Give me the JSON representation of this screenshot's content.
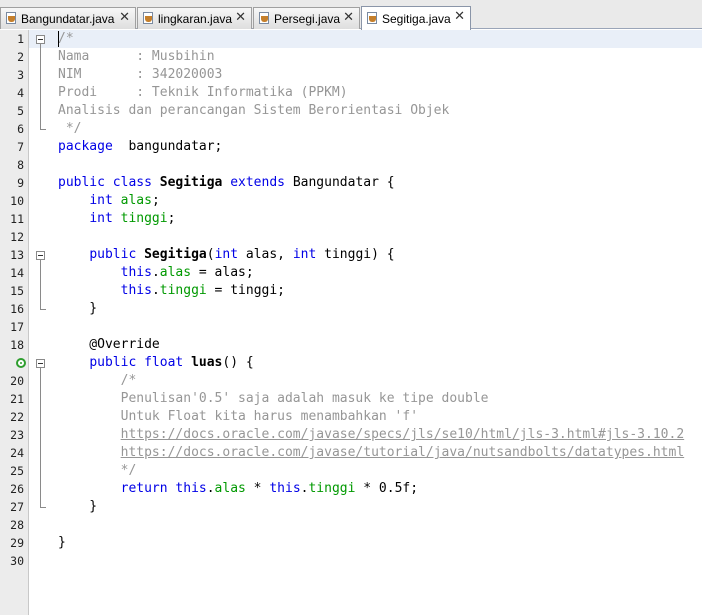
{
  "tabs": [
    {
      "label": "Bangundatar.java",
      "active": false
    },
    {
      "label": "lingkaran.java",
      "active": false
    },
    {
      "label": "Persegi.java",
      "active": false
    },
    {
      "label": "Segitiga.java",
      "active": true
    }
  ],
  "editor": {
    "line_numbers": [
      "1",
      "2",
      "3",
      "4",
      "5",
      "6",
      "7",
      "8",
      "9",
      "10",
      "11",
      "12",
      "13",
      "14",
      "15",
      "16",
      "17",
      "18",
      "19",
      "20",
      "21",
      "22",
      "23",
      "24",
      "25",
      "26",
      "27",
      "28",
      "29",
      "30"
    ],
    "override_icon": "override-annotation-icon",
    "lines": [
      {
        "n": 1,
        "tokens": [
          [
            "cm",
            "/*"
          ]
        ]
      },
      {
        "n": 2,
        "tokens": [
          [
            "cm",
            "Nama      : Musbihin"
          ]
        ]
      },
      {
        "n": 3,
        "tokens": [
          [
            "cm",
            "NIM       : 342020003"
          ]
        ]
      },
      {
        "n": 4,
        "tokens": [
          [
            "cm",
            "Prodi     : Teknik Informatika (PPKM)"
          ]
        ]
      },
      {
        "n": 5,
        "tokens": [
          [
            "cm",
            "Analisis dan perancangan Sistem Berorientasi Objek"
          ]
        ]
      },
      {
        "n": 6,
        "tokens": [
          [
            "cm",
            " */"
          ]
        ]
      },
      {
        "n": 7,
        "tokens": [
          [
            "kw",
            "package"
          ],
          [
            "",
            "  bangundatar;"
          ]
        ]
      },
      {
        "n": 8,
        "tokens": []
      },
      {
        "n": 9,
        "tokens": [
          [
            "kw",
            "public class"
          ],
          [
            "",
            " "
          ],
          [
            "b",
            "Segitiga"
          ],
          [
            "",
            " "
          ],
          [
            "kw",
            "extends"
          ],
          [
            "",
            " Bangundatar {"
          ]
        ]
      },
      {
        "n": 10,
        "tokens": [
          [
            "",
            "    "
          ],
          [
            "kw",
            "int"
          ],
          [
            "",
            " "
          ],
          [
            "fld",
            "alas"
          ],
          [
            "",
            ";"
          ]
        ]
      },
      {
        "n": 11,
        "tokens": [
          [
            "",
            "    "
          ],
          [
            "kw",
            "int"
          ],
          [
            "",
            " "
          ],
          [
            "fld",
            "tinggi"
          ],
          [
            "",
            ";"
          ]
        ]
      },
      {
        "n": 12,
        "tokens": []
      },
      {
        "n": 13,
        "tokens": [
          [
            "",
            "    "
          ],
          [
            "kw",
            "public"
          ],
          [
            "",
            " "
          ],
          [
            "b",
            "Segitiga"
          ],
          [
            "",
            "("
          ],
          [
            "kw",
            "int"
          ],
          [
            "",
            " alas, "
          ],
          [
            "kw",
            "int"
          ],
          [
            "",
            " tinggi) {"
          ]
        ]
      },
      {
        "n": 14,
        "tokens": [
          [
            "",
            "        "
          ],
          [
            "kw",
            "this"
          ],
          [
            "",
            "."
          ],
          [
            "fld",
            "alas"
          ],
          [
            "",
            " = alas;"
          ]
        ]
      },
      {
        "n": 15,
        "tokens": [
          [
            "",
            "        "
          ],
          [
            "kw",
            "this"
          ],
          [
            "",
            "."
          ],
          [
            "fld",
            "tinggi"
          ],
          [
            "",
            " = tinggi;"
          ]
        ]
      },
      {
        "n": 16,
        "tokens": [
          [
            "",
            "    }"
          ]
        ]
      },
      {
        "n": 17,
        "tokens": []
      },
      {
        "n": 18,
        "tokens": [
          [
            "",
            "    @Override"
          ]
        ]
      },
      {
        "n": 19,
        "tokens": [
          [
            "",
            "    "
          ],
          [
            "kw",
            "public float"
          ],
          [
            "",
            " "
          ],
          [
            "b",
            "luas"
          ],
          [
            "",
            "() {"
          ]
        ]
      },
      {
        "n": 20,
        "tokens": [
          [
            "",
            "        "
          ],
          [
            "cm",
            "/*"
          ]
        ]
      },
      {
        "n": 21,
        "tokens": [
          [
            "",
            "        "
          ],
          [
            "cm",
            "Penulisan'0.5' saja adalah masuk ke tipe double"
          ]
        ]
      },
      {
        "n": 22,
        "tokens": [
          [
            "",
            "        "
          ],
          [
            "cm",
            "Untuk Float kita harus menambahkan 'f'"
          ]
        ]
      },
      {
        "n": 23,
        "tokens": [
          [
            "",
            "        "
          ],
          [
            "url",
            "https://docs.oracle.com/javase/specs/jls/se10/html/jls-3.html#jls-3.10.2"
          ]
        ]
      },
      {
        "n": 24,
        "tokens": [
          [
            "",
            "        "
          ],
          [
            "url",
            "https://docs.oracle.com/javase/tutorial/java/nutsandbolts/datatypes.html"
          ]
        ]
      },
      {
        "n": 25,
        "tokens": [
          [
            "",
            "        "
          ],
          [
            "cm",
            "*/"
          ]
        ]
      },
      {
        "n": 26,
        "tokens": [
          [
            "",
            "        "
          ],
          [
            "kw",
            "return this"
          ],
          [
            "",
            "."
          ],
          [
            "fld",
            "alas"
          ],
          [
            "",
            " * "
          ],
          [
            "kw",
            "this"
          ],
          [
            "",
            "."
          ],
          [
            "fld",
            "tinggi"
          ],
          [
            "",
            " * 0.5f;"
          ]
        ]
      },
      {
        "n": 27,
        "tokens": [
          [
            "",
            "    }"
          ]
        ]
      },
      {
        "n": 28,
        "tokens": []
      },
      {
        "n": 29,
        "tokens": [
          [
            "",
            "}"
          ]
        ]
      },
      {
        "n": 30,
        "tokens": []
      }
    ]
  }
}
